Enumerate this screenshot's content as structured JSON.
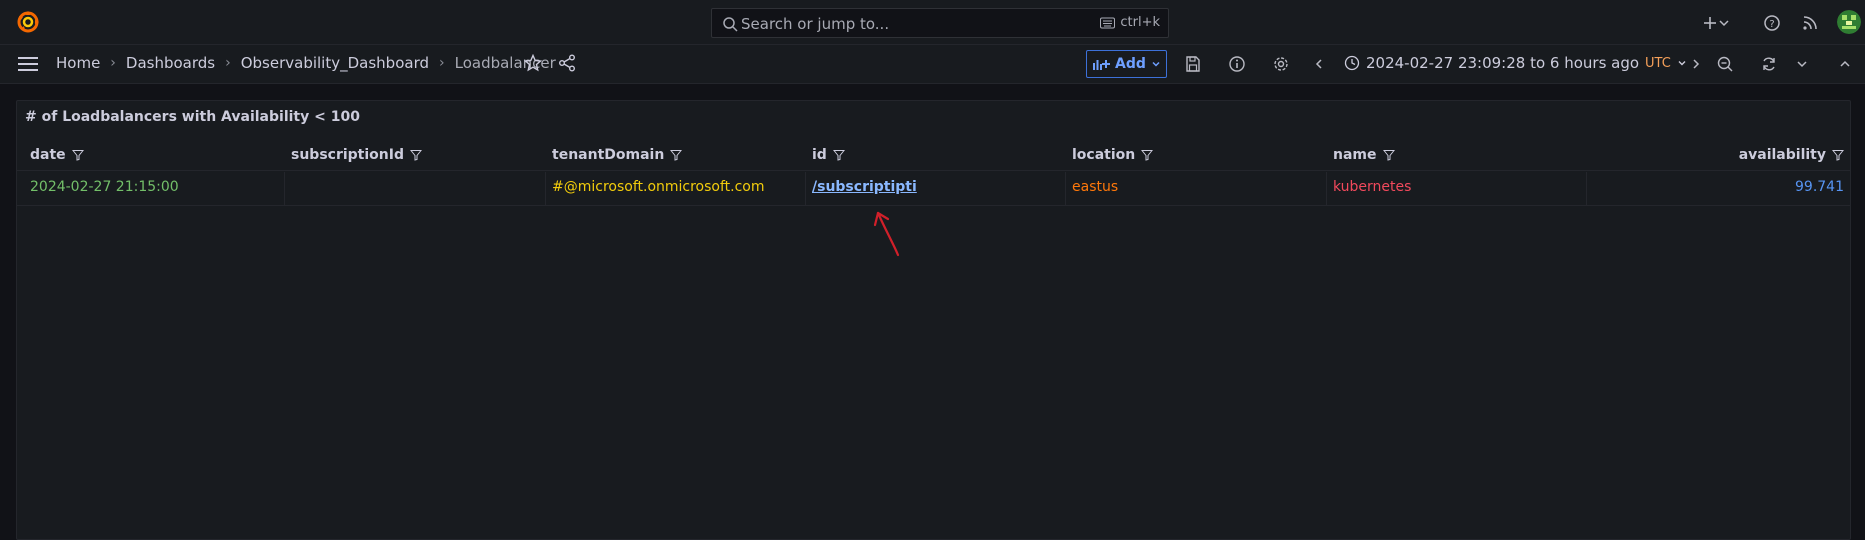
{
  "search": {
    "placeholder": "Search or jump to...",
    "shortcut": "ctrl+k"
  },
  "breadcrumb": [
    "Home",
    "Dashboards",
    "Observability_Dashboard",
    "Loadbalancer"
  ],
  "toolbar": {
    "add_label": "Add",
    "time_range": "2024-02-27 23:09:28 to 6 hours ago",
    "timezone": "UTC"
  },
  "panel": {
    "title": "# of Loadbalancers with Availability < 100",
    "columns": [
      "date",
      "subscriptionId",
      "tenantDomain",
      "id",
      "location",
      "name",
      "availability"
    ],
    "rows": [
      {
        "date": "2024-02-27 21:15:00",
        "subscriptionId": "",
        "tenantDomain": "#@microsoft.onmicrosoft.com",
        "id": "/subscriptipti",
        "location": "eastus",
        "name": "kubernetes",
        "availability": "99.741"
      }
    ]
  },
  "colors": {
    "date": "#73bf69",
    "tenantDomain": "#f2cc0c",
    "id": "#8ab8ff",
    "location": "#ff780a",
    "name": "#f2495c",
    "availability": "#5794f2",
    "annotation": "#d1202a"
  }
}
